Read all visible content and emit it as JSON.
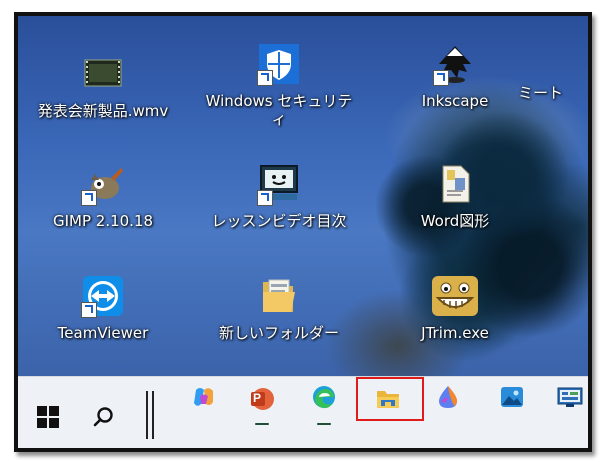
{
  "desktop": {
    "icons": [
      {
        "label": "発表会新製品.wmv",
        "icon": "video-file-icon"
      },
      {
        "label": "Windows セキュリテ",
        "label2": "ィ",
        "icon": "windows-security-shield-icon"
      },
      {
        "label": "Inkscape",
        "icon": "inkscape-icon"
      },
      {
        "label": "ミート",
        "icon": "meet-icon"
      },
      {
        "label": "GIMP 2.10.18",
        "icon": "gimp-icon"
      },
      {
        "label": "レッスンビデオ目次",
        "icon": "monitor-face-icon"
      },
      {
        "label": "Word図形",
        "icon": "document-file-icon"
      },
      {
        "label": "TeamViewer",
        "icon": "teamviewer-icon"
      },
      {
        "label": "新しいフォルダー",
        "icon": "folder-icon"
      },
      {
        "label": "JTrim.exe",
        "icon": "jtrim-face-icon"
      }
    ]
  },
  "taskbar": {
    "items": [
      {
        "name": "start",
        "icon": "windows-start-icon"
      },
      {
        "name": "search",
        "icon": "search-icon"
      },
      {
        "name": "copilot",
        "icon": "copilot-icon"
      },
      {
        "name": "powerpoint",
        "icon": "powerpoint-icon",
        "letter": "P"
      },
      {
        "name": "edge",
        "icon": "edge-icon"
      },
      {
        "name": "file-explorer",
        "icon": "file-explorer-icon"
      },
      {
        "name": "paint",
        "icon": "paint-drop-icon"
      },
      {
        "name": "photos",
        "icon": "photos-icon"
      },
      {
        "name": "control-panel",
        "icon": "control-panel-icon"
      }
    ],
    "highlighted": "file-explorer"
  },
  "colors": {
    "highlight_border": "#e11a1a",
    "taskbar_bg": "#eef2f7",
    "running_indicator": "#1c4f33"
  }
}
